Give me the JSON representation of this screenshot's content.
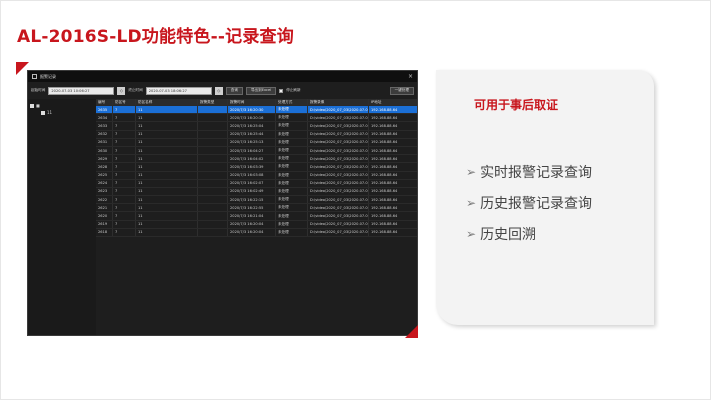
{
  "slide": {
    "title": "AL-2016S-LD功能特色--记录查询",
    "accent_color": "#c8161d"
  },
  "app": {
    "window_title": "报警记录",
    "close_glyph": "×",
    "toolbar": {
      "start_label": "起始时间",
      "start_value": "2020-07-03 10:06:27",
      "end_label": "终止时间",
      "end_value": "2020-07-03 18:06:27",
      "spin_glyph": "◇",
      "query_label": "查询",
      "export_label": "导出到Excel",
      "checkbox_label": "停止刷新",
      "one_key_label": "一键处理"
    },
    "tree": {
      "root_label": "■",
      "child_label": "11"
    },
    "columns": [
      "编号",
      "防区号",
      "防区名称",
      "报警类型",
      "报警时间",
      "处理方式",
      "报警录像",
      "IP地址"
    ],
    "rows": [
      [
        "2635",
        "7",
        "11",
        "",
        "2020/7/3 16:20:30",
        "未处理",
        "D:\\video\\2020_07_03\\2020.07.0...",
        "192.168.88.64"
      ],
      [
        "2634",
        "7",
        "11",
        "",
        "2020/7/3 16:20:16",
        "未处理",
        "D:\\video\\2020_07_03\\2020.07.0...",
        "192.168.88.64"
      ],
      [
        "2633",
        "7",
        "11",
        "",
        "2020/7/3 16:25:04",
        "未处理",
        "D:\\video\\2020_07_03\\2020.07.0...",
        "192.168.88.64"
      ],
      [
        "2632",
        "7",
        "11",
        "",
        "2020/7/3 16:25:44",
        "未处理",
        "D:\\video\\2020_07_03\\2020.07.0...",
        "192.168.88.64"
      ],
      [
        "2631",
        "7",
        "11",
        "",
        "2020/7/3 16:25:13",
        "未处理",
        "D:\\video\\2020_07_03\\2020.07.0...",
        "192.168.88.64"
      ],
      [
        "2630",
        "7",
        "11",
        "",
        "2020/7/3 16:04:27",
        "未处理",
        "D:\\video\\2020_07_03\\2020.07.0...",
        "192.168.88.64"
      ],
      [
        "2629",
        "7",
        "11",
        "",
        "2020/7/3 16:04:02",
        "未处理",
        "D:\\video\\2020_07_03\\2020.07.0...",
        "192.168.88.64"
      ],
      [
        "2628",
        "7",
        "11",
        "",
        "2020/7/3 16:03:39",
        "未处理",
        "D:\\video\\2020_07_03\\2020.07.0...",
        "192.168.88.64"
      ],
      [
        "2625",
        "7",
        "11",
        "",
        "2020/7/3 16:03:08",
        "未处理",
        "D:\\video\\2020_07_03\\2020.07.0...",
        "192.168.88.64"
      ],
      [
        "2624",
        "7",
        "11",
        "",
        "2020/7/3 16:02:07",
        "未处理",
        "D:\\video\\2020_07_03\\2020.07.0...",
        "192.168.88.64"
      ],
      [
        "2623",
        "7",
        "11",
        "",
        "2020/7/3 16:02:49",
        "未处理",
        "D:\\video\\2020_07_03\\2020.07.0...",
        "192.168.88.64"
      ],
      [
        "2622",
        "7",
        "11",
        "",
        "2020/7/3 16:22:15",
        "未处理",
        "D:\\video\\2020_07_03\\2020.07.0...",
        "192.168.88.64"
      ],
      [
        "2621",
        "7",
        "11",
        "",
        "2020/7/3 16:22:55",
        "未处理",
        "D:\\video\\2020_07_03\\2020.07.0...",
        "192.168.88.64"
      ],
      [
        "2620",
        "7",
        "11",
        "",
        "2020/7/3 16:21:04",
        "未处理",
        "D:\\video\\2020_07_03\\2020.07.0...",
        "192.168.88.64"
      ],
      [
        "2619",
        "7",
        "11",
        "",
        "2020/7/3 16:20:04",
        "未处理",
        "D:\\video\\2020_07_03\\2020.07.0...",
        "192.168.88.64"
      ],
      [
        "2618",
        "7",
        "11",
        "",
        "2020/7/3 16:20:04",
        "未处理",
        "D:\\video\\2020_07_03\\2020.07.0...",
        "192.168.88.64"
      ]
    ]
  },
  "panel": {
    "title": "可用于事后取证",
    "arrow_glyph": "➢",
    "bullets": [
      "实时报警记录查询",
      "历史报警记录查询",
      "历史回溯"
    ]
  }
}
